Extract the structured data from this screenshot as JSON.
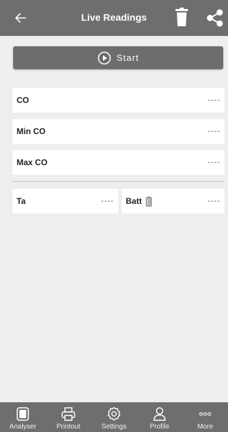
{
  "header": {
    "title": "Live Readings"
  },
  "start_button": {
    "label": "Start"
  },
  "readings": [
    {
      "label": "CO",
      "value": "----"
    },
    {
      "label": "Min CO",
      "value": "----"
    },
    {
      "label": "Max CO",
      "value": "----"
    }
  ],
  "bottom_row": {
    "ta": {
      "label": "Ta",
      "value": "----"
    },
    "batt": {
      "label": "Batt",
      "value": "----"
    }
  },
  "nav": [
    {
      "label": "Analyser",
      "icon": "analyser-icon"
    },
    {
      "label": "Printout",
      "icon": "printer-icon"
    },
    {
      "label": "Settings",
      "icon": "gear-icon"
    },
    {
      "label": "Profile",
      "icon": "user-icon"
    },
    {
      "label": "More",
      "icon": "more-icon"
    }
  ],
  "colors": {
    "bar": "#6e6e6e",
    "background": "#eeeeee",
    "card": "#ffffff"
  }
}
